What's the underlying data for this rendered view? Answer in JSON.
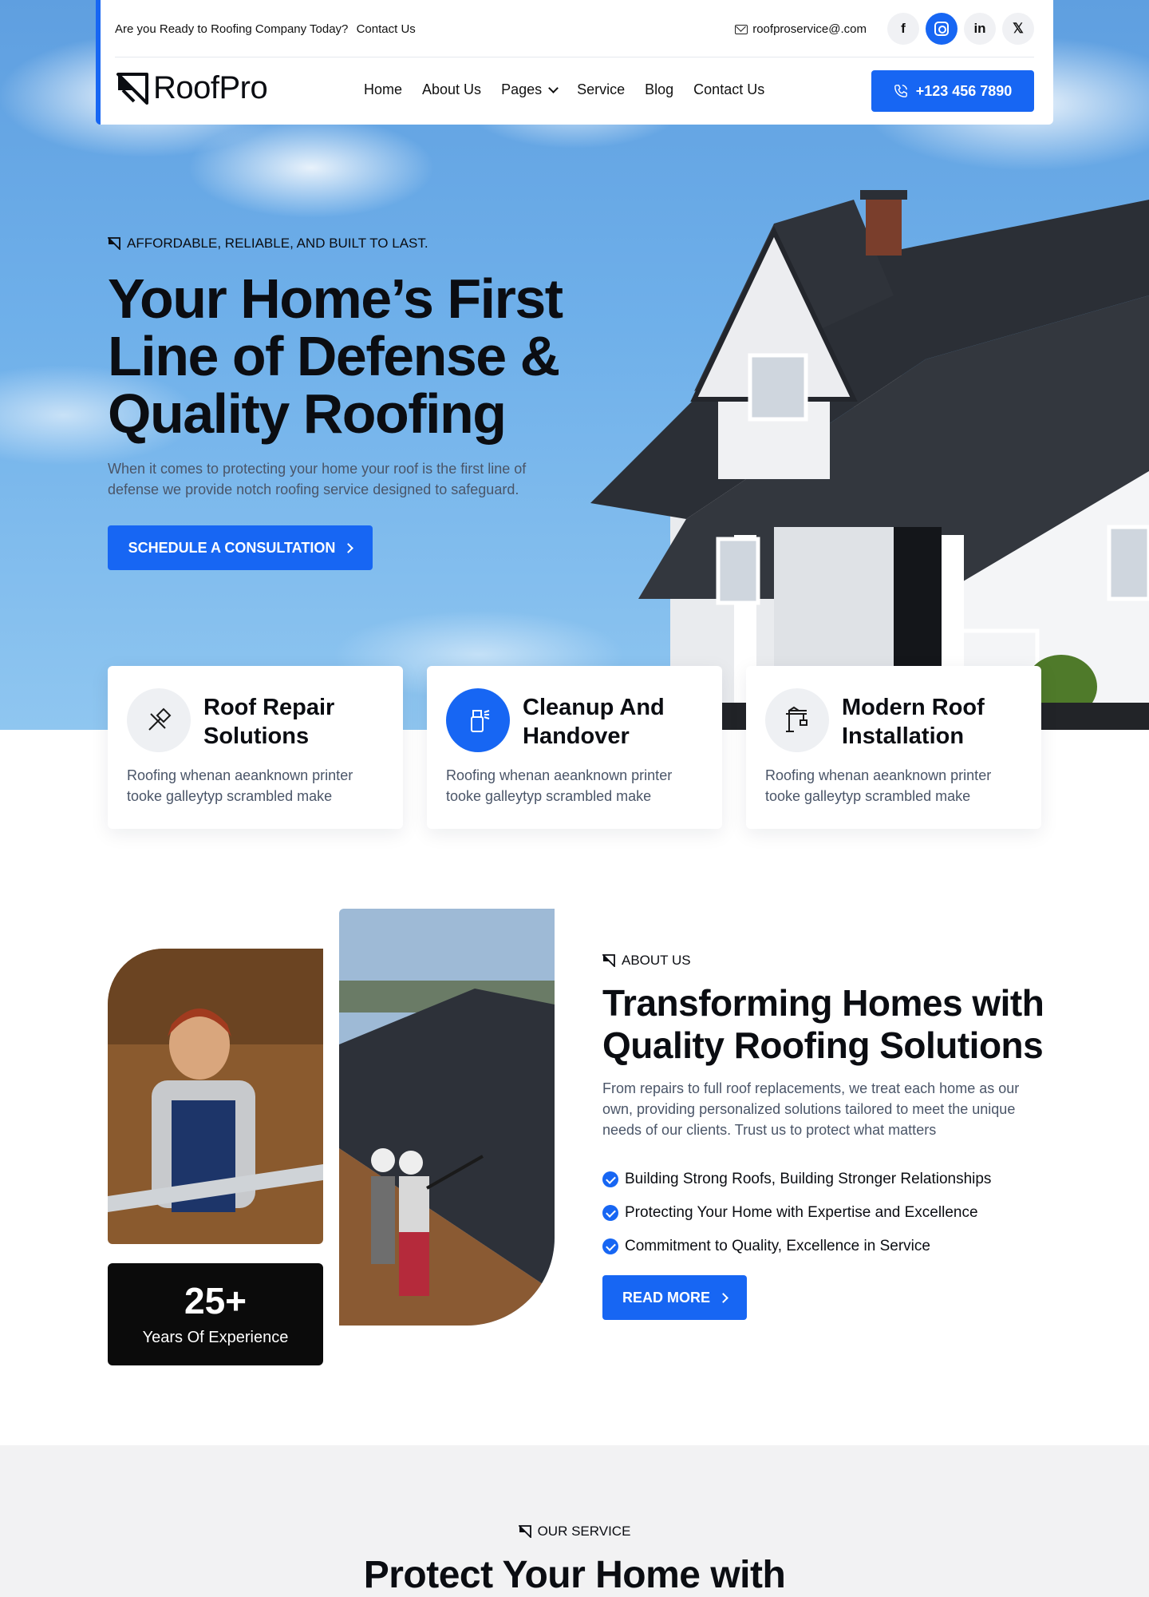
{
  "topbar": {
    "prompt": "Are you Ready to Roofing Company Today?",
    "contact_link": "Contact Us",
    "email": "roofproservice@.com",
    "socials": [
      "f",
      "instagram",
      "in",
      "X"
    ]
  },
  "brand": {
    "name": "RoofPro"
  },
  "nav": {
    "items": [
      "Home",
      "About Us",
      "Pages",
      "Service",
      "Blog",
      "Contact Us"
    ],
    "phone": "+123 456 7890"
  },
  "hero": {
    "tagline": "AFFORDABLE, RELIABLE, AND BUILT TO LAST.",
    "title": "Your Home’s First Line of Defense & Quality Roofing",
    "description": "When it comes to protecting your home your roof is the first line of defense we provide notch roofing service designed to safeguard.",
    "cta": "SCHEDULE A CONSULTATION"
  },
  "features": [
    {
      "title": "Roof Repair Solutions",
      "description": "Roofing whenan aeanknown printer tooke galleytyp scrambled make",
      "icon": "tools-icon"
    },
    {
      "title": "Cleanup And Handover",
      "description": "Roofing whenan aeanknown printer tooke galleytyp scrambled make",
      "icon": "spray-bottle-icon"
    },
    {
      "title": "Modern Roof Installation",
      "description": "Roofing whenan aeanknown printer tooke galleytyp scrambled make",
      "icon": "crane-icon"
    }
  ],
  "about": {
    "tag": "ABOUT US",
    "title": "Transforming Homes with Quality Roofing Solutions",
    "description": "From repairs to full roof replacements, we treat each home as our own, providing personalized solutions tailored to meet the unique needs of our clients. Trust us to protect what matters",
    "checklist": [
      "Building Strong Roofs, Building Stronger Relationships",
      "Protecting Your Home with Expertise and Excellence",
      "Commitment to Quality, Excellence in Service"
    ],
    "button": "READ MORE",
    "experience_number": "25+",
    "experience_label": "Years Of Experience"
  },
  "services": {
    "tag": "OUR SERVICE",
    "title": "Protect Your Home with"
  },
  "colors": {
    "accent": "#1766f3",
    "dark": "#0b0d12",
    "muted": "#4a5568",
    "section_bg": "#f2f2f3"
  }
}
